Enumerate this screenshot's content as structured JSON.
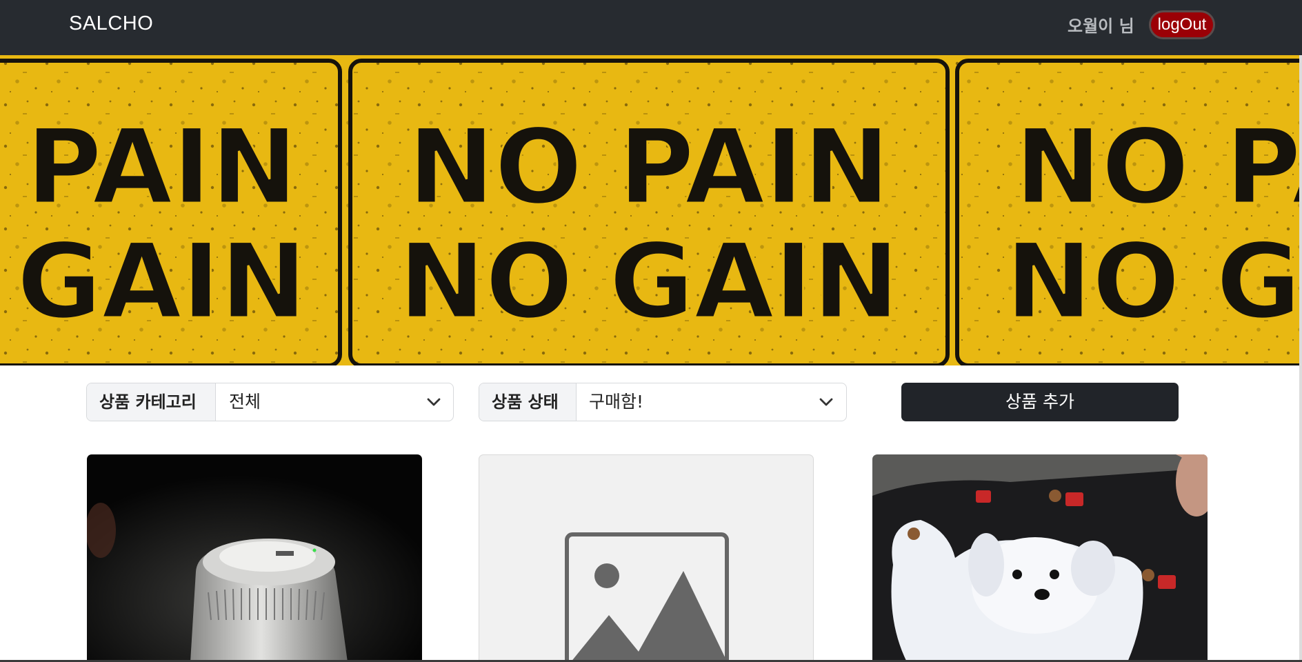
{
  "navbar": {
    "brand": "SALCHO",
    "username": "오월이 님",
    "logout_label": "logOut"
  },
  "banner": {
    "line1": "NO PAIN",
    "line2": "NO GAIN"
  },
  "filters": {
    "category_label": "상품 카테고리",
    "category_value": "전체",
    "status_label": "상품 상태",
    "status_value": "구매함!"
  },
  "add_product_label": "상품 추가",
  "products": [
    {
      "image": "air-purifier-photo"
    },
    {
      "image": "image-placeholder-icon"
    },
    {
      "image": "white-dog-photo"
    }
  ],
  "colors": {
    "navbar": "#272b30",
    "logout": "#9b0006",
    "banner": "#e8b812",
    "button": "#212429"
  }
}
